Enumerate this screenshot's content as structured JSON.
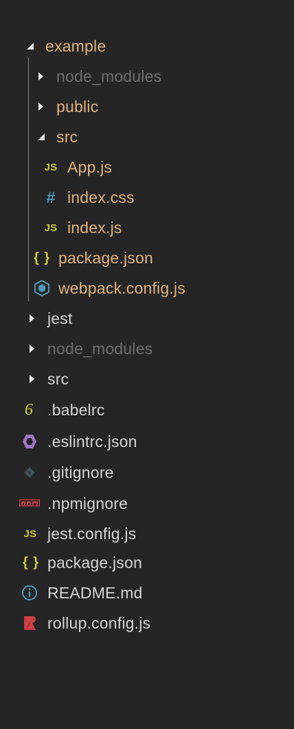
{
  "explorer": {
    "items": [
      {
        "label": "example",
        "kind": "folder",
        "state": "open",
        "color": "#e2b37f"
      },
      {
        "label": "node_modules",
        "kind": "folder",
        "state": "closed",
        "color": "#6e6e6e"
      },
      {
        "label": "public",
        "kind": "folder",
        "state": "closed",
        "color": "#e2b37f"
      },
      {
        "label": "src",
        "kind": "folder",
        "state": "open",
        "color": "#e2b37f"
      },
      {
        "label": "App.js",
        "kind": "file",
        "icon": "js-icon",
        "color": "#e2b37f"
      },
      {
        "label": "index.css",
        "kind": "file",
        "icon": "hash-icon",
        "color": "#e2b37f"
      },
      {
        "label": "index.js",
        "kind": "file",
        "icon": "js-icon",
        "color": "#e2b37f"
      },
      {
        "label": "package.json",
        "kind": "file",
        "icon": "braces-icon",
        "color": "#e2b37f"
      },
      {
        "label": "webpack.config.js",
        "kind": "file",
        "icon": "webpack-cube-icon",
        "color": "#e2b37f"
      },
      {
        "label": "jest",
        "kind": "folder",
        "state": "closed",
        "color": "#d4d4d4"
      },
      {
        "label": "node_modules",
        "kind": "folder",
        "state": "closed",
        "color": "#6e6e6e"
      },
      {
        "label": "src",
        "kind": "folder",
        "state": "closed",
        "color": "#d4d4d4"
      },
      {
        "label": ".babelrc",
        "kind": "file",
        "icon": "babel-icon",
        "color": "#d4d4d4"
      },
      {
        "label": ".eslintrc.json",
        "kind": "file",
        "icon": "eslint-icon",
        "color": "#d4d4d4"
      },
      {
        "label": ".gitignore",
        "kind": "file",
        "icon": "git-icon",
        "color": "#d4d4d4"
      },
      {
        "label": ".npmignore",
        "kind": "file",
        "icon": "npm-icon",
        "color": "#d4d4d4"
      },
      {
        "label": "jest.config.js",
        "kind": "file",
        "icon": "js-icon",
        "color": "#d4d4d4"
      },
      {
        "label": "package.json",
        "kind": "file",
        "icon": "braces-icon",
        "color": "#d4d4d4"
      },
      {
        "label": "README.md",
        "kind": "file",
        "icon": "info-icon",
        "color": "#d4d4d4"
      },
      {
        "label": "rollup.config.js",
        "kind": "file",
        "icon": "rollup-icon",
        "color": "#d4d4d4"
      }
    ],
    "icon_glyphs": {
      "js": "JS",
      "hash": "#",
      "braces": "{ }",
      "babel": "6"
    },
    "icon_colors": {
      "js": "#cbcb41",
      "css": "#519aba",
      "json": "#cbcb41",
      "webpack": "#519aba",
      "eslint": "#a074c4",
      "git": "#41535b",
      "npm": "#cc3e44",
      "info": "#519aba",
      "rollup": "#cc3e44"
    }
  }
}
